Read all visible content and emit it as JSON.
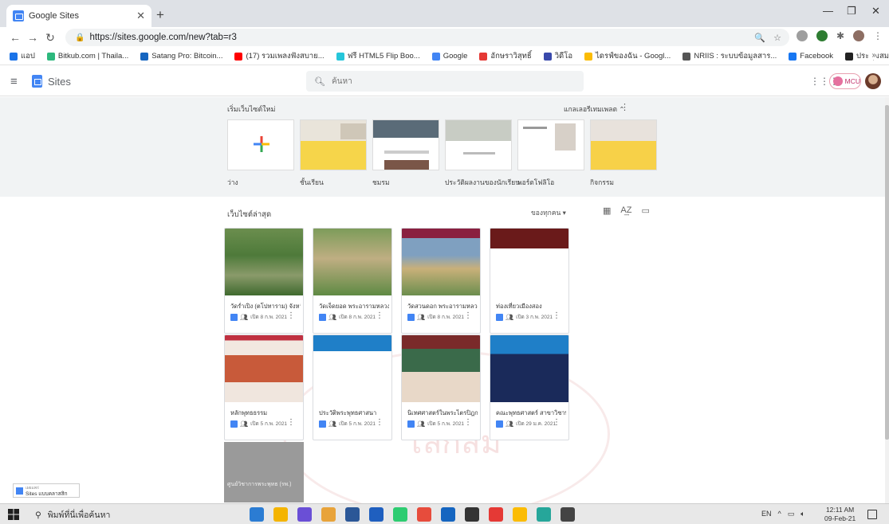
{
  "browser": {
    "tab_title": "Google Sites",
    "url": "https://sites.google.com/new?tab=r3",
    "bookmarks": [
      {
        "label": "แอป",
        "color": "#1a73e8"
      },
      {
        "label": "Bitkub.com | Thaila...",
        "color": "#2db87d"
      },
      {
        "label": "Satang Pro: Bitcoin...",
        "color": "#1565c0"
      },
      {
        "label": "(17) รวมเพลงฟังสบาย...",
        "color": "#ff0000"
      },
      {
        "label": "ฟรี HTML5 Flip Boo...",
        "color": "#26c6da"
      },
      {
        "label": "Google",
        "color": "#4285f4"
      },
      {
        "label": "อักษราวิสุทธิ์",
        "color": "#e53935"
      },
      {
        "label": "วิดีโอ",
        "color": "#3949ab"
      },
      {
        "label": "ไดรฟ์ของฉัน - Googl...",
        "color": "#fbbc04"
      },
      {
        "label": "NRIIS : ระบบข้อมูลสาร...",
        "color": "#555555"
      },
      {
        "label": "Facebook",
        "color": "#1877f2"
      },
      {
        "label": "ประชุมสมาคม, การพัฒนา...",
        "color": "#222222"
      }
    ],
    "bookmarks_overflow": "»"
  },
  "app": {
    "name": "Sites",
    "search_placeholder": "ค้นหา",
    "account_badge": "MCU"
  },
  "gallery": {
    "title": "เริ่มเว็บไซต์ใหม่",
    "toggle_label": "แกลเลอรีเทมเพลต",
    "templates": [
      {
        "label": "ว่าง"
      },
      {
        "label": "ชั้นเรียน"
      },
      {
        "label": "ชมรม"
      },
      {
        "label": "ประวัติผลงานของนักเรียน"
      },
      {
        "label": "พอร์ตโฟลิโอ"
      },
      {
        "label": "กิจกรรม"
      }
    ]
  },
  "recent": {
    "title": "เว็บไซต์ล่าสุด",
    "owner_filter": "ของทุกคน ▾",
    "sites": [
      {
        "title": "วัดร่ำเปิง (ตโปทาราม) จังหวัด...",
        "meta": "เปิด 8 ก.พ. 2021"
      },
      {
        "title": "วัดเจ็ดยอด พระอารามหลวง จ.",
        "meta": "เปิด 8 ก.พ. 2021"
      },
      {
        "title": "วัดสวนดอก พระอารามหลวง ...",
        "meta": "เปิด 8 ก.พ. 2021"
      },
      {
        "title": "ท่องเที่ยวเมืองสอง",
        "meta": "เปิด 3 ก.พ. 2021"
      },
      {
        "title": "หลักพุทธธรรม",
        "meta": "เปิด 5 ก.พ. 2021"
      },
      {
        "title": "ประวัติพระพุทธศาสนา",
        "meta": "เปิด 5 ก.พ. 2021"
      },
      {
        "title": "นิเทศศาสตร์ในพระไตรปิฎก",
        "meta": "เปิด 5 ก.พ. 2021"
      },
      {
        "title": "คณะพุทธศาสตร์ สาขาวิชาพร...",
        "meta": "เปิด 29 ม.ค. 2021"
      }
    ],
    "bottom_card_label": "ศูนย์วิชาการพระพุทธ (รพ.)"
  },
  "watermark": {
    "text": "โลกสม"
  },
  "toast": {
    "line1": "เผยแพร่",
    "line2": "Sites แบบคลาสสิก"
  },
  "taskbar": {
    "search_text": "พิมพ์ที่นี่เพื่อค้นหา",
    "lang": "EN",
    "time": "12:11 AM",
    "date": "09-Feb-21",
    "apps": [
      "#2b7cd3",
      "#f4b400",
      "#6a4fd6",
      "#e8a33a",
      "#2b5797",
      "#1f5fbf",
      "#2ecc71",
      "#e74c3c",
      "#1565c0",
      "#333333",
      "#e53935",
      "#fbbc04",
      "#26a69a",
      "#444444"
    ]
  }
}
